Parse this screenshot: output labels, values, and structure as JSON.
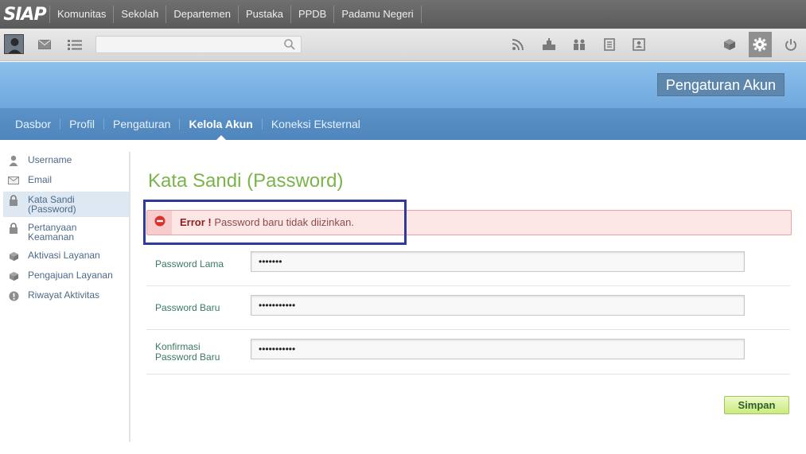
{
  "app": {
    "logo_text": "SIAP"
  },
  "top_nav": {
    "items": [
      {
        "label": "Komunitas"
      },
      {
        "label": "Sekolah"
      },
      {
        "label": "Departemen"
      },
      {
        "label": "Pustaka"
      },
      {
        "label": "PPDB"
      },
      {
        "label": "Padamu Negeri"
      }
    ]
  },
  "toolbar": {
    "search": {
      "value": "",
      "placeholder": ""
    },
    "left_icons": [
      "user-avatar",
      "envelope-icon",
      "list-icon"
    ],
    "right_icons": [
      "rss-icon",
      "school-icon",
      "group-icon",
      "document-icon",
      "contact-card-icon",
      "cube-icon",
      "gear-icon",
      "power-icon"
    ]
  },
  "banner": {
    "title": "Pengaturan Akun"
  },
  "sub_nav": {
    "items": [
      {
        "label": "Dasbor"
      },
      {
        "label": "Profil"
      },
      {
        "label": "Pengaturan"
      },
      {
        "label": "Kelola Akun",
        "active": true
      },
      {
        "label": "Koneksi Eksternal"
      }
    ]
  },
  "sidebar": {
    "items": [
      {
        "label": "Username",
        "icon": "user-icon"
      },
      {
        "label": "Email",
        "icon": "envelope-icon"
      },
      {
        "label": "Kata Sandi\n(Password)",
        "icon": "lock-icon",
        "active": true
      },
      {
        "label": "Pertanyaan\nKeamanan",
        "icon": "lock-icon"
      },
      {
        "label": "Aktivasi Layanan",
        "icon": "box-icon"
      },
      {
        "label": "Pengajuan Layanan",
        "icon": "box-icon"
      },
      {
        "label": "Riwayat Aktivitas",
        "icon": "alert-icon"
      }
    ]
  },
  "main": {
    "title": "Kata Sandi (Password)",
    "error": {
      "prefix": "Error !",
      "message": " Password baru tidak diizinkan."
    },
    "fields": [
      {
        "label": "Password Lama",
        "value": "•••••••"
      },
      {
        "label": "Password Baru",
        "value": "•••••••••••"
      },
      {
        "label": "Konfirmasi\nPassword Baru",
        "value": "•••••••••••"
      }
    ],
    "save_label": "Simpan"
  },
  "colors": {
    "topbar": "#666666",
    "banner": "#7db4e4",
    "subnav": "#5590c6",
    "title_green": "#7ab44a",
    "error_bg": "#fde6e6",
    "highlight_border": "#2e3b9c",
    "save_button": "#c9ec7c"
  }
}
